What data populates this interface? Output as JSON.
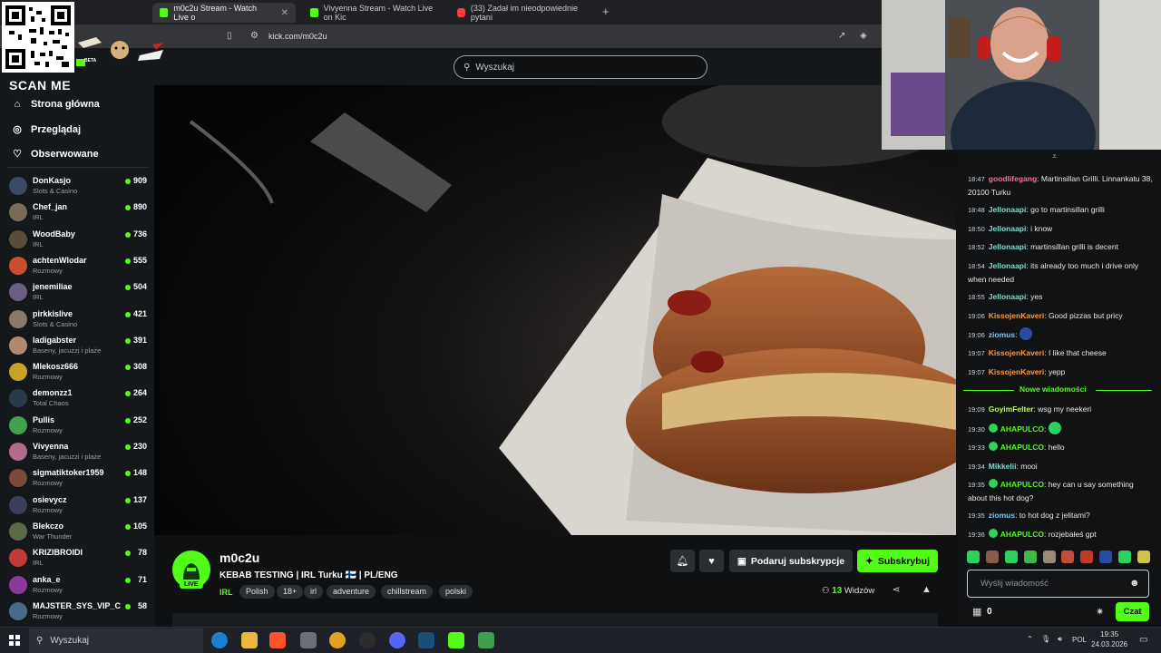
{
  "browser": {
    "tabs": [
      {
        "label": "m0c2u Stream - Watch Live o",
        "close": "✕",
        "active": true,
        "favicon_color": "#53fc18"
      },
      {
        "label": "Vivyenna Stream - Watch Live on Kic",
        "active": false,
        "favicon_color": "#53fc18"
      },
      {
        "label": "(33) Zadał im nieodpowiednie pytani",
        "active": false,
        "favicon_color": "#ff3b3b"
      }
    ],
    "new_tab": "+",
    "address": "kick.com/m0c2u"
  },
  "overlay": {
    "scan_me": "SCAN ME",
    "beta": "BETA"
  },
  "header": {
    "search_placeholder": "Wyszukaj"
  },
  "sidebar": {
    "nav": [
      {
        "label": "Strona główna",
        "icon": "home-icon"
      },
      {
        "label": "Przeglądaj",
        "icon": "compass-icon"
      },
      {
        "label": "Obserwowane",
        "icon": "heart-icon"
      }
    ],
    "channels": [
      {
        "name": "DonKasjo",
        "category": "Slots & Casino",
        "viewers": "909",
        "color": "#3a4a63"
      },
      {
        "name": "Chef_jan",
        "category": "IRL",
        "viewers": "890",
        "color": "#7a6a58"
      },
      {
        "name": "WoodBaby",
        "category": "IRL",
        "viewers": "736",
        "color": "#5a4d3e"
      },
      {
        "name": "achtenWlodar",
        "category": "Rozmowy",
        "viewers": "555",
        "color": "#c7502a"
      },
      {
        "name": "jenemiliae",
        "category": "IRL",
        "viewers": "504",
        "color": "#6b5e80"
      },
      {
        "name": "pirkkislive",
        "category": "Slots & Casino",
        "viewers": "421",
        "color": "#8a7a6a"
      },
      {
        "name": "ladigabster",
        "category": "Baseny, jacuzzi i plaże",
        "viewers": "391",
        "color": "#b08a70"
      },
      {
        "name": "Mlekosz666",
        "category": "Rozmowy",
        "viewers": "308",
        "color": "#c9a227"
      },
      {
        "name": "demonzz1",
        "category": "Total Chaos",
        "viewers": "264",
        "color": "#2a3a4a"
      },
      {
        "name": "Pullis",
        "category": "Rozmowy",
        "viewers": "252",
        "color": "#3fa34d"
      },
      {
        "name": "Vivyenna",
        "category": "Baseny, jacuzzi i plaże",
        "viewers": "230",
        "color": "#b06a8a"
      },
      {
        "name": "sigmatiktoker1959",
        "category": "Rozmowy",
        "viewers": "148",
        "color": "#7a4a3a"
      },
      {
        "name": "osievycz",
        "category": "Rozmowy",
        "viewers": "137",
        "color": "#3a3f5a"
      },
      {
        "name": "Blekczo",
        "category": "War Thunder",
        "viewers": "105",
        "color": "#5a6a4a"
      },
      {
        "name": "KRIZIBROIDI",
        "category": "IRL",
        "viewers": "78",
        "color": "#c43a3a"
      },
      {
        "name": "anka_e",
        "category": "Rozmowy",
        "viewers": "71",
        "color": "#8a3a9a"
      },
      {
        "name": "MAJSTER_SYS_VIP_C",
        "category": "Rozmowy",
        "viewers": "58",
        "color": "#4a6a8a"
      }
    ]
  },
  "stream": {
    "streamer": "m0c2u",
    "live": "LIVE",
    "title": "KEBAB TESTING | IRL Turku 🇫🇮 | PL/ENG",
    "category": "IRL",
    "tags": [
      "Polish",
      "18+",
      "irl",
      "adventure",
      "chillstream",
      "polski"
    ],
    "gift_label": "Podaruj subskrypcje",
    "subscribe_label": "Subskrybuj",
    "viewers_count": "13",
    "viewers_label": "Widzów"
  },
  "chat": {
    "messages": [
      {
        "time": "18:47",
        "user": "goodlifegang",
        "color": "#ff6f8f",
        "text": "Martinsillan Grilli. Linnankatu 38, 20100 Turku"
      },
      {
        "time": "18:48",
        "user": "Jellonaapi",
        "color": "#7be0d0",
        "text": "go to martinsillan grilli"
      },
      {
        "time": "18:50",
        "user": "Jellonaapi",
        "color": "#7be0d0",
        "text": "i know"
      },
      {
        "time": "18:52",
        "user": "Jellonaapi",
        "color": "#7be0d0",
        "text": "martinsillan grilli is decent"
      },
      {
        "time": "18:54",
        "user": "Jellonaapi",
        "color": "#7be0d0",
        "text": "its already too much i drive only when needed"
      },
      {
        "time": "18:55",
        "user": "Jellonaapi",
        "color": "#7be0d0",
        "text": "yes"
      },
      {
        "time": "19:06",
        "user": "KissojenKaveri",
        "color": "#ff9a3c",
        "text": "Good pizzas but pricy"
      },
      {
        "time": "19:06",
        "user": "ziomus",
        "color": "#7ec8ff",
        "text": ""
      },
      {
        "time": "19:07",
        "user": "KissojenKaveri",
        "color": "#ff9a3c",
        "text": "I like that cheese"
      },
      {
        "time": "19:07",
        "user": "KissojenKaveri",
        "color": "#ff9a3c",
        "text": "yepp"
      },
      {
        "time": "19:09",
        "user": "GoyimFelter",
        "color": "#b6ff4a",
        "text": "wsg my neekeri"
      },
      {
        "time": "19:30",
        "user": "AHAPULCO",
        "color": "#53fc18",
        "text": ""
      },
      {
        "time": "19:33",
        "user": "AHAPULCO",
        "color": "#53fc18",
        "text": "hello"
      },
      {
        "time": "19:34",
        "user": "Mikkelii",
        "color": "#7be0d0",
        "text": "mooi"
      },
      {
        "time": "19:35",
        "user": "AHAPULCO",
        "color": "#53fc18",
        "text": "hey can u say something about this hot dog?"
      },
      {
        "time": "19:35",
        "user": "ziomus",
        "color": "#7ec8ff",
        "text": "to hot dog z jelitami?"
      },
      {
        "time": "19:36",
        "user": "AHAPULCO",
        "color": "#53fc18",
        "text": "rozjebałeś gpt"
      }
    ],
    "new_messages_divider": "Nowe wiadomości",
    "input_placeholder": "Wyślij wiadomość",
    "points": "0",
    "send_label": "Czat"
  },
  "taskbar": {
    "search": "Wyszukaj",
    "lang": "POL",
    "time": "19:35",
    "date": "24.03.2026"
  }
}
